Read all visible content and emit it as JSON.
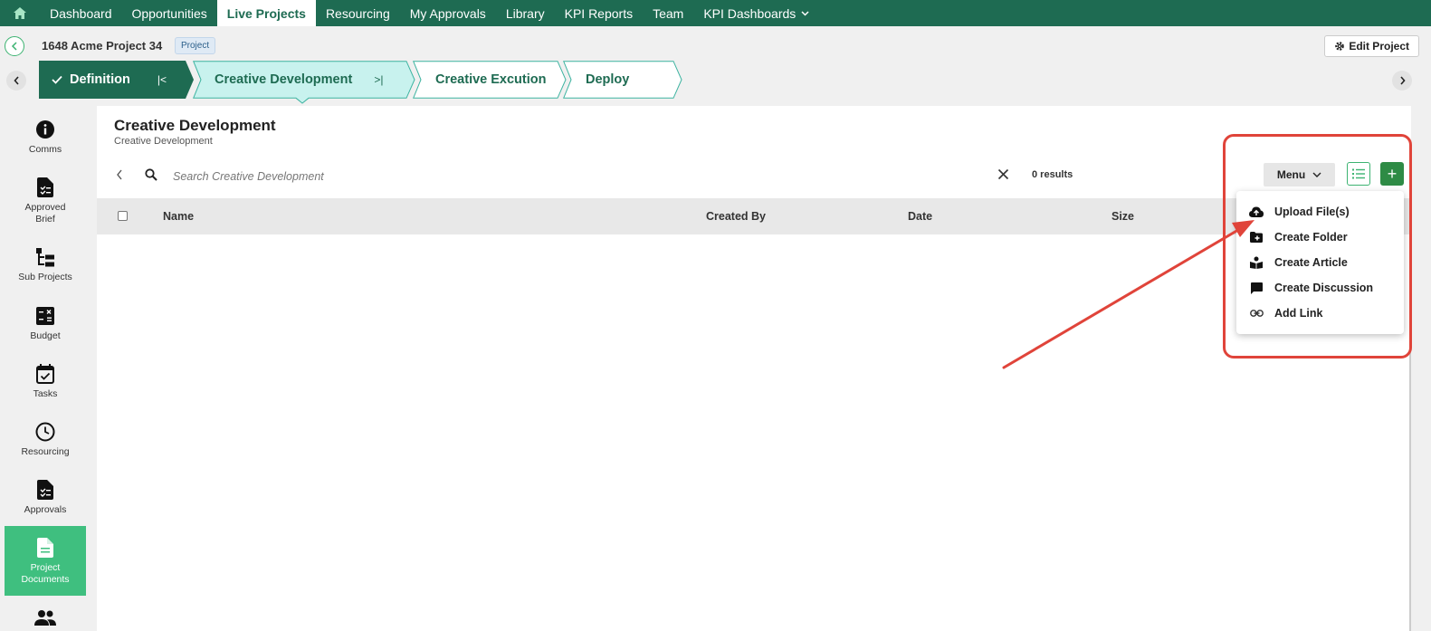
{
  "top_nav": {
    "items": [
      {
        "label": "Dashboard"
      },
      {
        "label": "Opportunities"
      },
      {
        "label": "Live Projects"
      },
      {
        "label": "Resourcing"
      },
      {
        "label": "My Approvals"
      },
      {
        "label": "Library"
      },
      {
        "label": "KPI Reports"
      },
      {
        "label": "Team"
      },
      {
        "label": "KPI Dashboards"
      }
    ],
    "active": "Live Projects"
  },
  "project": {
    "title": "1648 Acme Project 34",
    "badge": "Project",
    "edit_label": "Edit Project"
  },
  "stages": [
    {
      "label": "Definition",
      "state": "complete"
    },
    {
      "label": "Creative Development",
      "state": "current"
    },
    {
      "label": "Creative Excution",
      "state": "upcoming"
    },
    {
      "label": "Deploy",
      "state": "upcoming"
    }
  ],
  "sidebar": {
    "items": [
      {
        "label": "Comms",
        "icon": "info-icon"
      },
      {
        "label": "Approved Brief",
        "icon": "brief-doc-icon"
      },
      {
        "label": "Sub Projects",
        "icon": "tree-icon"
      },
      {
        "label": "Budget",
        "icon": "calculator-icon"
      },
      {
        "label": "Tasks",
        "icon": "calendar-check-icon"
      },
      {
        "label": "Resourcing",
        "icon": "clock-icon"
      },
      {
        "label": "Approvals",
        "icon": "approval-doc-icon"
      },
      {
        "label": "Project Documents",
        "icon": "document-icon"
      },
      {
        "label": "",
        "icon": "people-icon"
      }
    ],
    "active": "Project Documents"
  },
  "main": {
    "title": "Creative Development",
    "subtitle": "Creative Development",
    "search_placeholder": "Search Creative Development",
    "results": "0 results",
    "menu_label": "Menu",
    "add_label": "+",
    "columns": [
      "Name",
      "Created By",
      "Date",
      "Size"
    ]
  },
  "dropdown": {
    "items": [
      {
        "label": "Upload File(s)",
        "icon": "cloud-upload-icon"
      },
      {
        "label": "Create Folder",
        "icon": "folder-add-icon"
      },
      {
        "label": "Create Article",
        "icon": "article-icon"
      },
      {
        "label": "Create Discussion",
        "icon": "chat-icon"
      },
      {
        "label": "Add Link",
        "icon": "link-icon"
      }
    ]
  },
  "colors": {
    "brand": "#1e6b52",
    "accent": "#3fbf7f",
    "annotation": "#e0443a"
  }
}
